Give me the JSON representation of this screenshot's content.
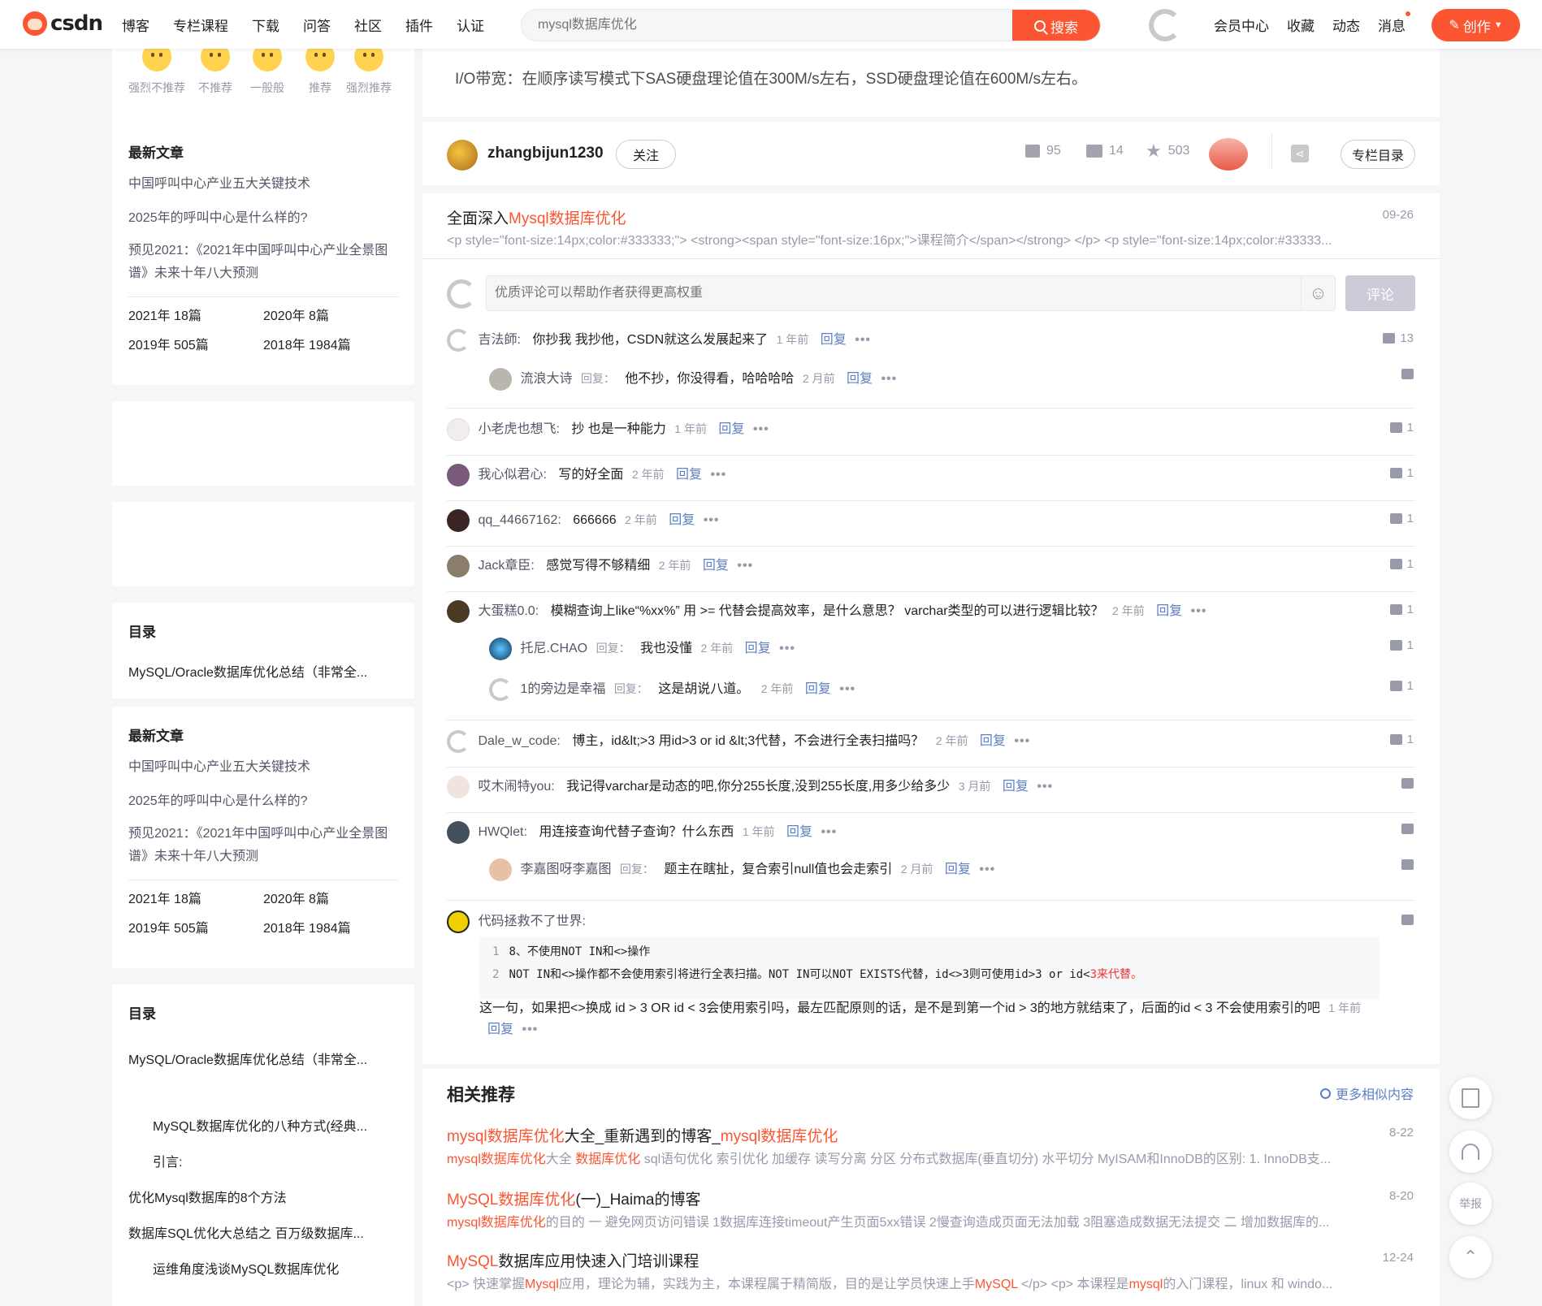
{
  "header": {
    "logo_text": "CSDN",
    "nav": [
      "博客",
      "专栏课程",
      "下载",
      "问答",
      "社区",
      "插件",
      "认证"
    ],
    "search_placeholder": "mysql数据库优化",
    "search_btn": "搜索",
    "right_links": [
      "会员中心",
      "收藏",
      "动态",
      "消息"
    ],
    "create_btn": "创作"
  },
  "sidebar": {
    "emotions": [
      "强烈不推荐",
      "不推荐",
      "一般般",
      "推荐",
      "强烈推荐"
    ],
    "recent_title": "最新文章",
    "recent": [
      "中国呼叫中心产业五大关键技术",
      "2025年的呼叫中心是什么样的?",
      "预见2021：《2021年中国呼叫中心产业全景图谱》未来十年八大预测"
    ],
    "archive": [
      "2021年 18篇",
      "2020年 8篇",
      "2019年 505篇",
      "2018年 1984篇"
    ],
    "toc_title": "目录",
    "toc_short": "MySQL/Oracle数据库优化总结（非常全...",
    "toc": [
      "MySQL/Oracle数据库优化总结（非常全...",
      "MySQL数据库优化的八种方式(经典...",
      "引言:",
      "优化Mysql数据库的8个方法",
      "数据库SQL优化大总结之 百万级数据库...",
      "运维角度浅谈MySQL数据库优化"
    ]
  },
  "article": {
    "io_text": "I/O带宽：在顺序读写模式下SAS硬盘理论值在300M/s左右，SSD硬盘理论值在600M/s左右。"
  },
  "author": {
    "name": "zhangbijun1230",
    "follow": "关注",
    "likes": "95",
    "comments": "14",
    "stars": "503",
    "toc_btn": "专栏目录"
  },
  "column": {
    "title_prefix": "全面深入",
    "title_hl": "Mysql数据库优化",
    "date": "09-26",
    "desc": "<p style=\"font-size:14px;color:#333333;\"> <strong><span style=\"font-size:16px;\">课程简介</span></strong> </p> <p style=\"font-size:14px;color:#33333..."
  },
  "comment_box": {
    "placeholder": "优质评论可以帮助作者获得更高权重",
    "submit": "评论"
  },
  "comments": [
    {
      "name": "吉法師:",
      "text": "你抄我 我抄他，CSDN就这么发展起来了",
      "time": "1 年前",
      "reply": "回复",
      "likes": "13"
    },
    {
      "name": "流浪大诗",
      "label": "回复：",
      "text": "他不抄，你没得看，哈哈哈哈",
      "time": "2 月前",
      "reply": "回复"
    },
    {
      "name": "小老虎也想飞:",
      "text": "抄 也是一种能力",
      "time": "1 年前",
      "reply": "回复",
      "likes": "1"
    },
    {
      "name": "我心似君心:",
      "text": "写的好全面",
      "time": "2 年前",
      "reply": "回复",
      "likes": "1"
    },
    {
      "name": "qq_44667162:",
      "text": "666666",
      "time": "2 年前",
      "reply": "回复",
      "likes": "1"
    },
    {
      "name": "Jack章臣:",
      "text": "感觉写得不够精细",
      "time": "2 年前",
      "reply": "回复",
      "likes": "1"
    },
    {
      "name": "大蛋糕0.0:",
      "text": "模糊查询上like“%xx%” 用 >= 代替会提高效率，是什么意思？ varchar类型的可以进行逻辑比较？",
      "time": "2 年前",
      "reply": "回复",
      "likes": "1"
    },
    {
      "name": "托尼.CHAO",
      "label": "回复：",
      "text": "我也没懂",
      "time": "2 年前",
      "reply": "回复",
      "likes": "1"
    },
    {
      "name": "1的旁边是幸福",
      "label": "回复：",
      "text": "这是胡说八道。",
      "time": "2 年前",
      "reply": "回复",
      "likes": "1"
    },
    {
      "name": "Dale_w_code:",
      "text": "博主，id&lt;>3 用id>3 or id &lt;3代替，不会进行全表扫描吗？",
      "time": "2 年前",
      "reply": "回复",
      "likes": "1"
    },
    {
      "name": "哎木闹特you:",
      "text": "我记得varchar是动态的吧,你分255长度,没到255长度,用多少给多少",
      "time": "3 月前",
      "reply": "回复"
    },
    {
      "name": "HWQlet:",
      "text": "用连接查询代替子查询？什么东西",
      "time": "1 年前",
      "reply": "回复"
    },
    {
      "name": "李嘉图呀李嘉图",
      "label": "回复：",
      "text": "题主在瞎扯，复合索引null值也会走索引",
      "time": "2 月前",
      "reply": "回复"
    },
    {
      "name": "代码拯救不了世界:",
      "text": "这一句，如果把<>换成 id > 3 OR id < 3会使用索引吗，最左匹配原则的话，是不是到第一个id > 3的地方就结束了，后面的id < 3 不会使用索引的吧",
      "time": "1 年前",
      "reply": "回复"
    }
  ],
  "code_lines": [
    {
      "num": "1",
      "text": "8、不使用NOT IN和<>操作"
    },
    {
      "num": "2",
      "text": "NOT IN和<>操作都不会使用索引将进行全表扫描。NOT IN可以NOT EXISTS代替，id<>3则可使用id>3 or id<",
      "hl": "3来代替。"
    }
  ],
  "related": {
    "title": "相关推荐",
    "more": "更多相似内容",
    "items": [
      {
        "title_hl": "mysql数据库优化",
        "title_rest": "大全_重新遇到的博客_",
        "title_hl2": "mysql数据库优化",
        "date": "8-22",
        "desc_hl": "mysql数据库优化",
        "desc_rest": "大全 ",
        "desc_hl2": "数据库优化",
        "desc_tail": " sql语句优化 索引优化 加缓存 读写分离 分区 分布式数据库(垂直切分) 水平切分 MyISAM和InnoDB的区别: 1. InnoDB支..."
      },
      {
        "title_hl": "MySQL数据库优化",
        "title_rest": "(一)_Haima的博客",
        "date": "8-20",
        "desc_hl": "mysql数据库优化",
        "desc_tail": "的目的 一 避免网页访问错误 1数据库连接timeout产生页面5xx错误 2慢查询造成页面无法加载 3阻塞造成数据无法提交 二 增加数据库的..."
      },
      {
        "title_hl": "MySQL",
        "title_rest": "数据库应用快速入门培训课程",
        "date": "12-24",
        "desc_pre": "<p> 快速掌握",
        "desc_hl": "Mysql",
        "desc_mid": "应用，理论为辅，实践为主，本课程属于精简版，目的是让学员快速上手",
        "desc_hl2": "MySQL",
        "desc_tail": " </p> <p> 本课程是",
        "desc_hl3": "mysql",
        "desc_end": "的入门课程，linux 和 windo..."
      }
    ]
  },
  "float": {
    "report": "举报"
  }
}
